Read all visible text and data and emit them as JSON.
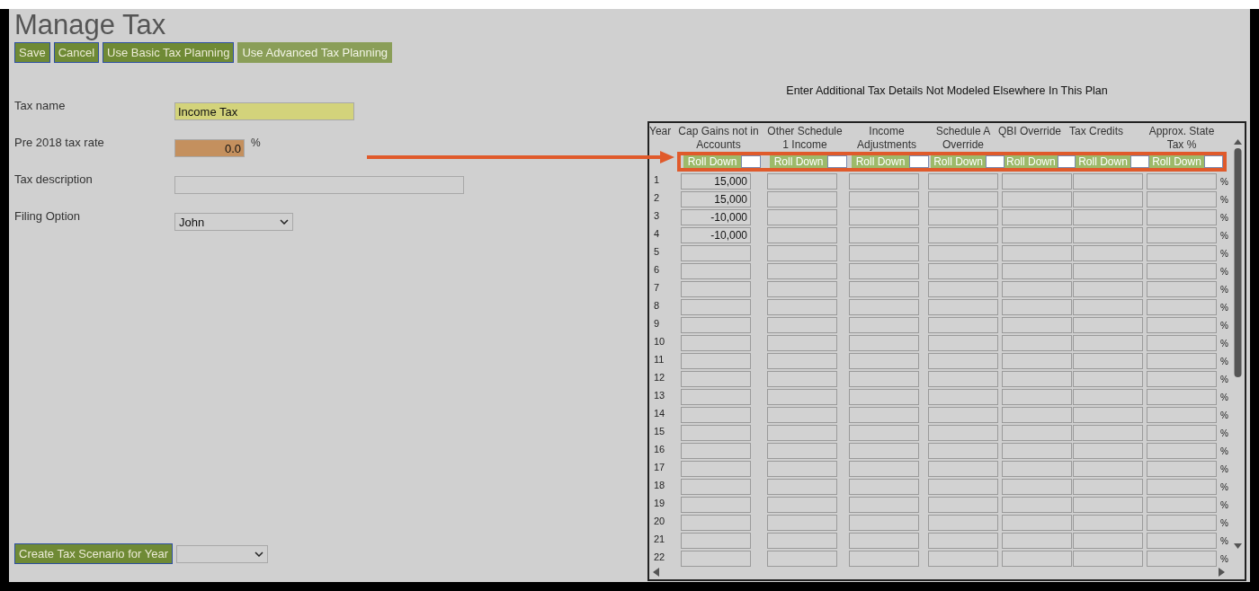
{
  "page": {
    "title": "Manage Tax"
  },
  "buttons": [
    {
      "label": "Save",
      "disabled": false
    },
    {
      "label": "Cancel",
      "disabled": false
    },
    {
      "label": "Use Basic Tax Planning",
      "disabled": false
    },
    {
      "label": "Use Advanced Tax Planning",
      "disabled": true
    }
  ],
  "form": [
    {
      "kind": "text",
      "label": "Tax name",
      "value": "Income Tax",
      "color": "#d3d37b"
    },
    {
      "kind": "number",
      "label": "Pre 2018 tax rate",
      "value": "0.0",
      "unit": "%",
      "color": "#c4905e"
    },
    {
      "kind": "text",
      "label": "Tax description"
    },
    {
      "kind": "select",
      "label": "Filing Option",
      "value": "John"
    }
  ],
  "scenario": {
    "button": "Create Tax Scenario for Year"
  },
  "details": {
    "title": "Enter Additional Tax Details Not Modeled Elsewhere In This Plan",
    "year_header": "Year",
    "columns": [
      {
        "header": "Cap Gains not in Accounts",
        "roll_button": "Roll Down"
      },
      {
        "header": "Other Schedule 1 Income",
        "roll_button": "Roll Down"
      },
      {
        "header": "Income Adjustments",
        "roll_button": "Roll Down"
      },
      {
        "header": "Schedule A Override",
        "roll_button": "Roll Down"
      },
      {
        "header": "QBI Override",
        "roll_button": "Roll Down"
      },
      {
        "header": "Tax Credits",
        "roll_button": "Roll Down"
      },
      {
        "header": "Approx. State Tax %",
        "roll_button": "Roll Down"
      }
    ],
    "rows": [
      {
        "year": "1",
        "cap_gains": "15,000",
        "unit": "%"
      },
      {
        "year": "2",
        "cap_gains": "15,000",
        "unit": "%"
      },
      {
        "year": "3",
        "cap_gains": "-10,000",
        "unit": "%"
      },
      {
        "year": "4",
        "cap_gains": "-10,000",
        "unit": "%"
      },
      {
        "year": "5",
        "unit": "%"
      },
      {
        "year": "6",
        "unit": "%"
      },
      {
        "year": "7",
        "unit": "%"
      },
      {
        "year": "8",
        "unit": "%"
      },
      {
        "year": "9",
        "unit": "%"
      },
      {
        "year": "10",
        "unit": "%"
      },
      {
        "year": "11",
        "unit": "%"
      },
      {
        "year": "12",
        "unit": "%"
      },
      {
        "year": "13",
        "unit": "%"
      },
      {
        "year": "14",
        "unit": "%"
      },
      {
        "year": "15",
        "unit": "%"
      },
      {
        "year": "16",
        "unit": "%"
      },
      {
        "year": "17",
        "unit": "%"
      },
      {
        "year": "18",
        "unit": "%"
      },
      {
        "year": "19",
        "unit": "%"
      },
      {
        "year": "20",
        "unit": "%"
      },
      {
        "year": "21",
        "unit": "%"
      },
      {
        "year": "22",
        "unit": "%"
      }
    ]
  }
}
